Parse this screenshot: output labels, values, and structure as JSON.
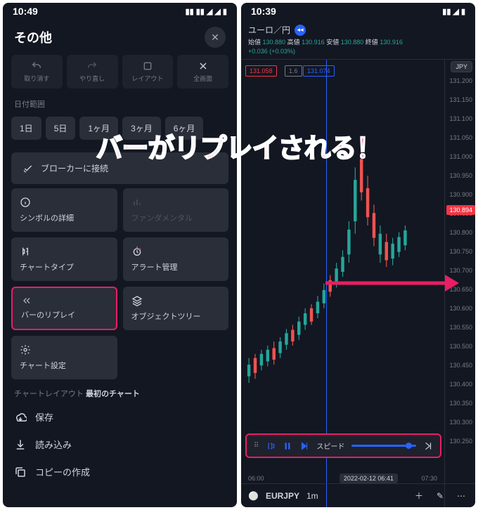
{
  "overlay": {
    "text": "バーがリプレイされる！"
  },
  "left": {
    "status": {
      "time": "10:49",
      "icons": "◂ ⸬ ⸬ 📶 📶 🔋"
    },
    "header": {
      "title": "その他",
      "close": "✕"
    },
    "tools": [
      {
        "icon": "undo",
        "label": "取り消す"
      },
      {
        "icon": "redo",
        "label": "やり直し"
      },
      {
        "icon": "layout",
        "label": "レイアウト"
      },
      {
        "icon": "fullscreen",
        "label": "全画面"
      }
    ],
    "dateRange": {
      "label": "日付範囲",
      "chips": [
        "1日",
        "5日",
        "1ヶ月",
        "3ヶ月",
        "6ヶ月"
      ]
    },
    "connect": {
      "label": "ブローカーに接続"
    },
    "grid": [
      {
        "id": "symbol-details",
        "icon": "info",
        "label": "シンボルの詳細",
        "disabled": false
      },
      {
        "id": "fundamental",
        "icon": "bars",
        "label": "ファンダメンタル",
        "disabled": true
      },
      {
        "id": "chart-type",
        "icon": "candles",
        "label": "チャートタイプ",
        "disabled": false
      },
      {
        "id": "alert-manage",
        "icon": "alert",
        "label": "アラート管理",
        "disabled": false
      },
      {
        "id": "bar-replay",
        "icon": "replay",
        "label": "バーのリプレイ",
        "disabled": false,
        "highlighted": true
      },
      {
        "id": "object-tree",
        "icon": "layers",
        "label": "オブジェクトツリー",
        "disabled": false
      },
      {
        "id": "chart-settings",
        "icon": "gear",
        "label": "チャート設定",
        "disabled": false
      }
    ],
    "layoutSection": {
      "label": "チャートレイアウト",
      "current": "最初のチャート",
      "items": [
        {
          "icon": "cloud",
          "label": "保存"
        },
        {
          "icon": "download",
          "label": "読み込み"
        },
        {
          "icon": "copy",
          "label": "コピーの作成"
        }
      ]
    }
  },
  "right": {
    "status": {
      "time": "10:39"
    },
    "symbol": "ユーロ／円",
    "ohlc": {
      "o": {
        "label": "始値",
        "value": "130.880"
      },
      "h": {
        "label": "高値",
        "value": "130.916"
      },
      "l": {
        "label": "安値",
        "value": "130.880"
      },
      "c": {
        "label": "終値",
        "value": "130.916"
      },
      "change": "+0.036 (+0.03%)"
    },
    "priceBadge1": "131.058",
    "priceBadge2": "131.074",
    "priceBadgeSpread": "1.6",
    "axisLabel": "JPY",
    "lastPrice": "130.894",
    "priceTicks": [
      "131.200",
      "131.150",
      "131.100",
      "131.050",
      "131.000",
      "130.950",
      "130.900",
      "130.850",
      "130.800",
      "130.750",
      "130.700",
      "130.650",
      "130.600",
      "130.550",
      "130.500",
      "130.450",
      "130.400",
      "130.350",
      "130.300",
      "130.250"
    ],
    "replay": {
      "speedLabel": "スピード"
    },
    "timeAxis": {
      "left": "06:00",
      "right": "07:30"
    },
    "timeBadge": "2022-02-12  06:41",
    "bottomBar": {
      "symbol": "EURJPY",
      "timeframe": "1m"
    }
  },
  "chart_data": {
    "type": "candlestick",
    "symbol": "EURJPY",
    "timeframe": "1m",
    "ylim": [
      130.25,
      131.2
    ],
    "crosshair_x": "2022-02-12 06:41",
    "last_price": 130.894,
    "note": "intraday candles visually rising from ~130.40 to spike above 131.00 then settling ~130.89; individual OHLC per candle not labeled"
  }
}
